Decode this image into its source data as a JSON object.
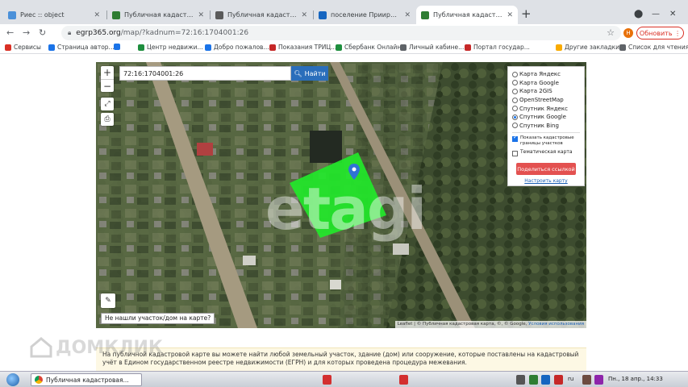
{
  "tabs": [
    {
      "title": "Риес :: object",
      "color": "#4a90d9"
    },
    {
      "title": "Публичная кадастровая ка",
      "color": "#2e7d32"
    },
    {
      "title": "Публичная кадастровая ка",
      "color": "#5a5a5a"
    },
    {
      "title": "поселение Прииртышский",
      "color": "#1565c0"
    },
    {
      "title": "Публичная кадастровая ка",
      "color": "#2e7d32"
    }
  ],
  "address": {
    "host": "egrp365.org",
    "path": "/map/?kadnum=72:16:1704001:26"
  },
  "profile_letter": "Н",
  "update_label": "Обновить",
  "bookmarks": [
    {
      "label": "Сервисы",
      "color": "#d93025"
    },
    {
      "label": "Страница автор...",
      "color": "#1a73e8"
    },
    {
      "label": "",
      "color": "#1a73e8"
    },
    {
      "label": "Центр недвижи...",
      "color": "#1e8e3e"
    },
    {
      "label": "Добро пожалов...",
      "color": "#1a73e8"
    },
    {
      "label": "Показания ТРИЦ...",
      "color": "#c62828"
    },
    {
      "label": "Сбербанк Онлайн",
      "color": "#1e8e3e"
    },
    {
      "label": "Личный кабине...",
      "color": "#5f6368"
    },
    {
      "label": "Портал государ...",
      "color": "#c62828"
    },
    {
      "label": "Другие закладки",
      "color": "#f9ab00"
    },
    {
      "label": "Список для чтения",
      "color": "#5f6368"
    }
  ],
  "map": {
    "search_value": "72:16:1704001:26",
    "find_label": "Найти",
    "layers": [
      {
        "label": "Карта Яндекс",
        "selected": false
      },
      {
        "label": "Карта Google",
        "selected": false
      },
      {
        "label": "Карта 2GIS",
        "selected": false
      },
      {
        "label": "OpenStreetMap",
        "selected": false
      },
      {
        "label": "Спутник Яндекс",
        "selected": false
      },
      {
        "label": "Спутник Google",
        "selected": true
      },
      {
        "label": "Спутник Bing",
        "selected": false
      }
    ],
    "show_boundaries_label": "Показать кадастровые границы участков",
    "show_boundaries_checked": true,
    "thematic_label": "Тематическая карта",
    "thematic_checked": false,
    "share_label": "Поделиться ссылкой",
    "setup_label": "Настроить карту",
    "not_found_label": "Не нашли участок/дом на карте?",
    "attribution_prefix": "Leaflet | © Публичная кадастровая карта, ©, © Google,",
    "attribution_link": "Условия использования",
    "watermark": "etagi",
    "parcel_color": "#22e82a"
  },
  "info_text": "На публичной кадастровой карте вы можете найти любой земельный участок, здание (дом) или сооружение, которые поставлены на кадастровый учёт в Едином государственном реестре недвижимости (ЕГРН) и для которых проведена процедура межевания.",
  "dom_watermark": "ДОМКЛИК",
  "taskbar": {
    "task_title": "Публичная кадастровая...",
    "lang": "ru",
    "datetime": "Пн., 18 апр., 14:33"
  }
}
